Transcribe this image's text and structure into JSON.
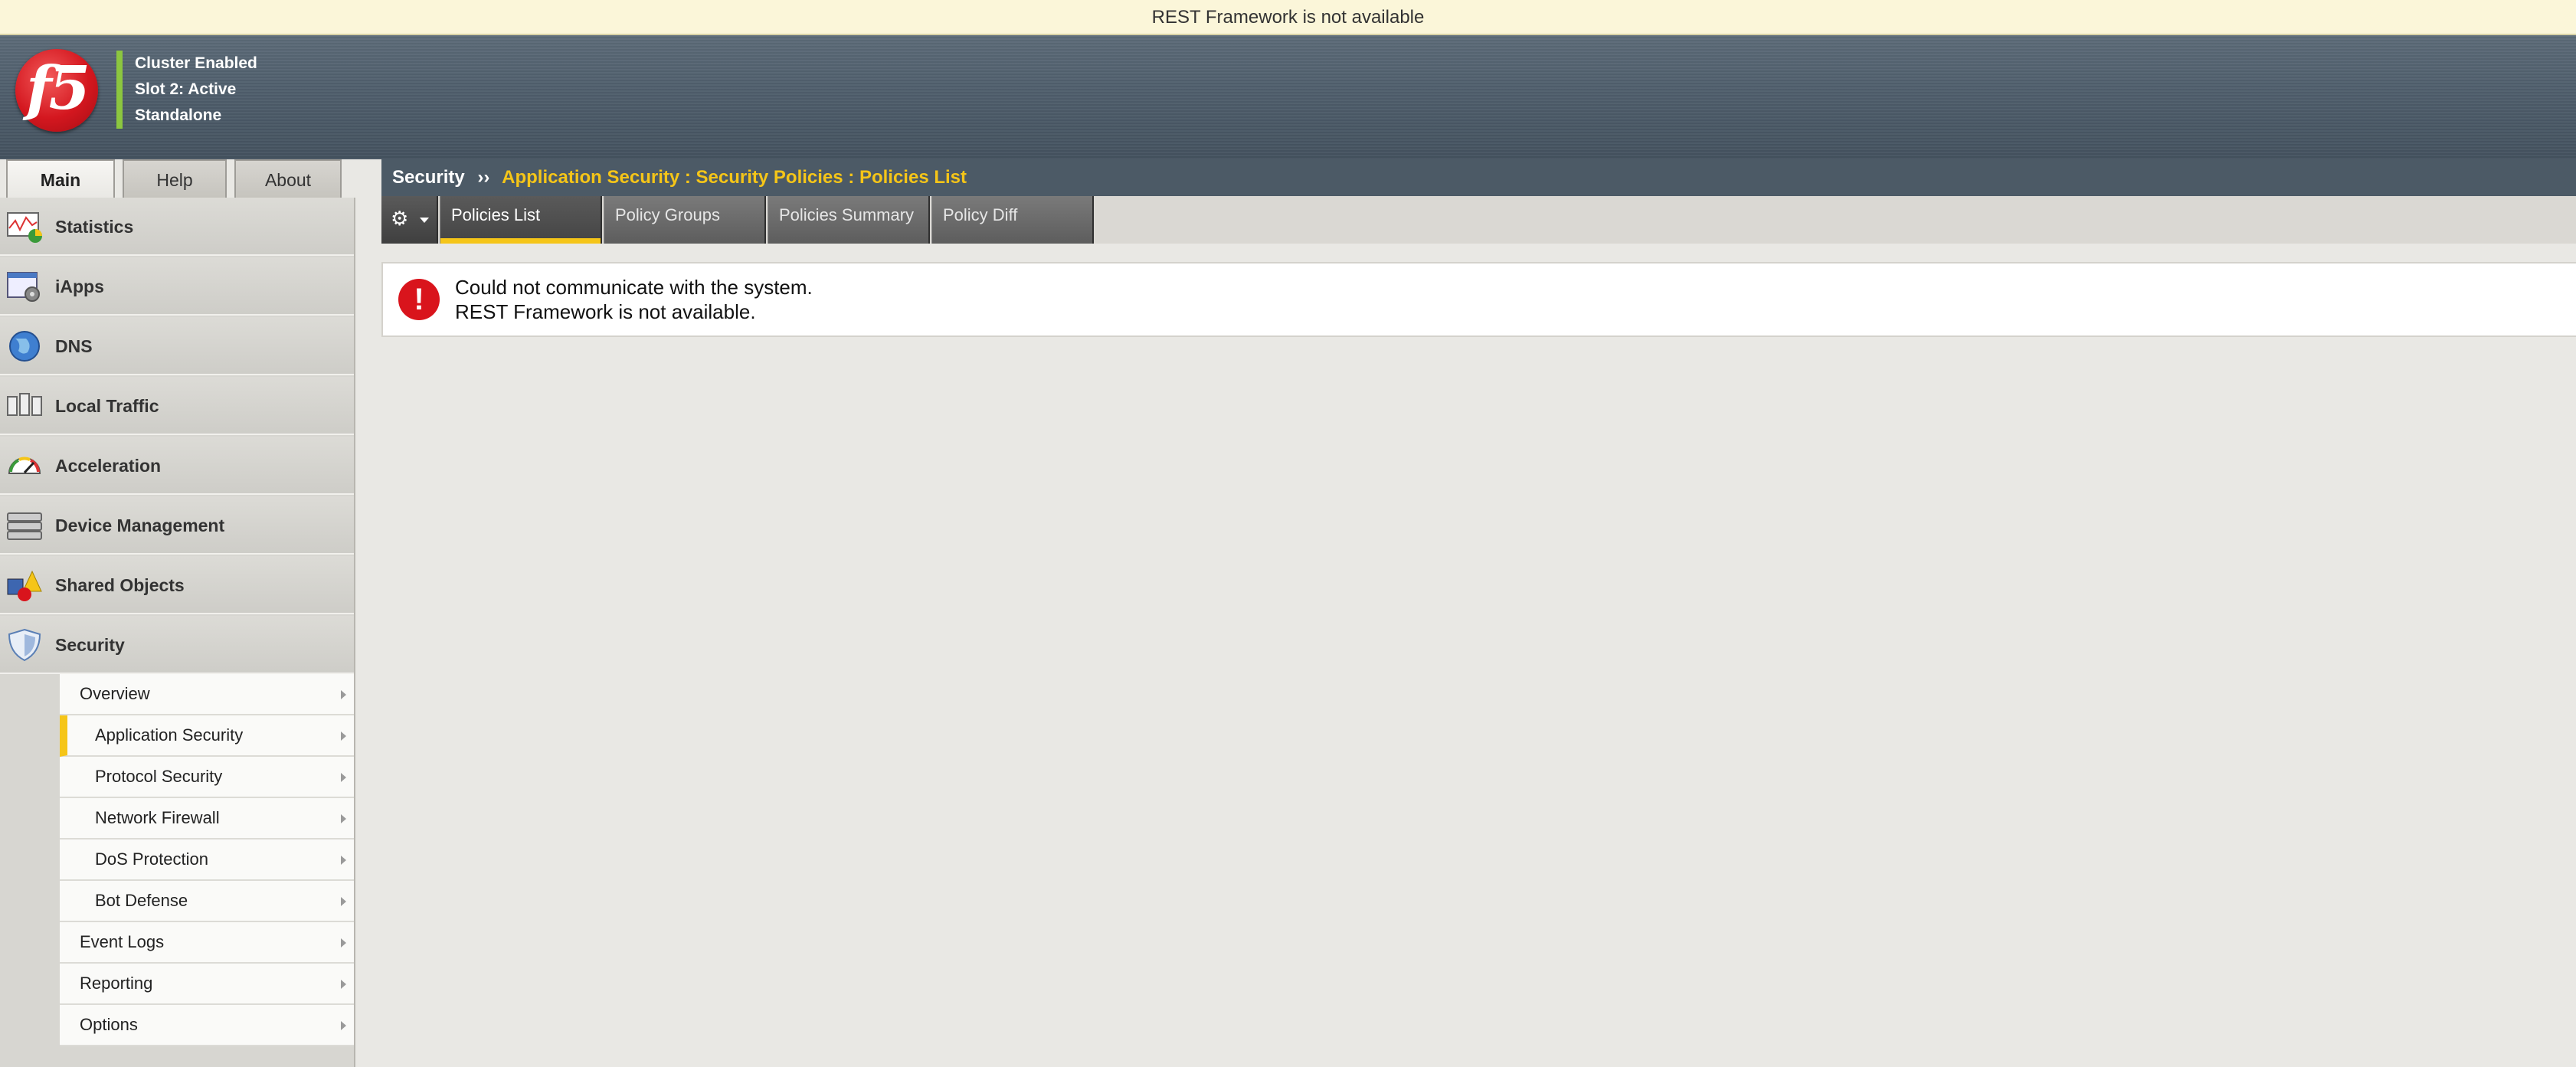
{
  "notice": {
    "text": "REST Framework is not available"
  },
  "header": {
    "logo_text": "f5",
    "status": [
      "Cluster Enabled",
      "Slot 2: Active",
      "Standalone"
    ]
  },
  "left_tabs": [
    {
      "label": "Main",
      "active": true
    },
    {
      "label": "Help",
      "active": false
    },
    {
      "label": "About",
      "active": false
    }
  ],
  "nav": {
    "items": [
      {
        "label": "Statistics",
        "icon": "statistics-icon"
      },
      {
        "label": "iApps",
        "icon": "iapps-icon"
      },
      {
        "label": "DNS",
        "icon": "dns-globe-icon"
      },
      {
        "label": "Local Traffic",
        "icon": "local-traffic-icon"
      },
      {
        "label": "Acceleration",
        "icon": "acceleration-gauge-icon"
      },
      {
        "label": "Device Management",
        "icon": "device-management-icon"
      },
      {
        "label": "Shared Objects",
        "icon": "shared-objects-icon"
      },
      {
        "label": "Security",
        "icon": "security-shield-icon"
      }
    ],
    "security_submenu": [
      {
        "label": "Overview",
        "child": false,
        "selected": false
      },
      {
        "label": "Application Security",
        "child": true,
        "selected": true
      },
      {
        "label": "Protocol Security",
        "child": true,
        "selected": false
      },
      {
        "label": "Network Firewall",
        "child": true,
        "selected": false
      },
      {
        "label": "DoS Protection",
        "child": true,
        "selected": false
      },
      {
        "label": "Bot Defense",
        "child": true,
        "selected": false
      },
      {
        "label": "Event Logs",
        "child": false,
        "selected": false
      },
      {
        "label": "Reporting",
        "child": false,
        "selected": false
      },
      {
        "label": "Options",
        "child": false,
        "selected": false
      }
    ]
  },
  "breadcrumb": {
    "root": "Security",
    "separator": "››",
    "path": "Application Security : Security Policies : Policies List"
  },
  "tabs": [
    {
      "label": "Policies List",
      "active": true
    },
    {
      "label": "Policy Groups",
      "active": false
    },
    {
      "label": "Policies Summary",
      "active": false
    },
    {
      "label": "Policy Diff",
      "active": false
    }
  ],
  "error": {
    "line1": "Could not communicate with the system.",
    "line2": "REST Framework is not available."
  },
  "colors": {
    "accent": "#f5c518",
    "header": "#4f5e6c",
    "error": "#d9141c",
    "status_indicator": "#8cc63f"
  }
}
